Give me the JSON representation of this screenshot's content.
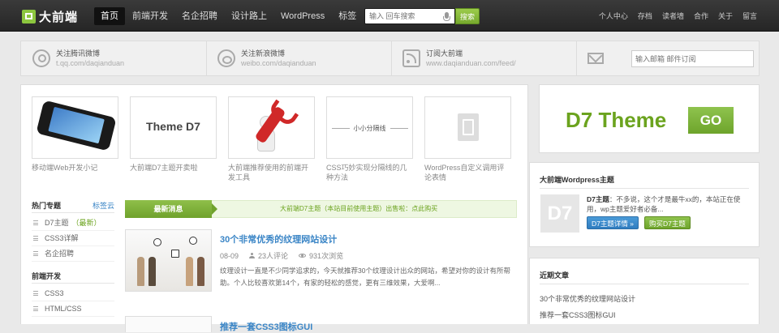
{
  "header": {
    "logo": "大前端",
    "nav": [
      "首页",
      "前端开发",
      "名企招聘",
      "设计路上",
      "WordPress",
      "标签"
    ],
    "search_placeholder": "输入 回车搜索",
    "search_button": "搜索",
    "right_links": [
      "个人中心",
      "存档",
      "读者墙",
      "合作",
      "关于",
      "留言"
    ]
  },
  "followbar": {
    "items": [
      {
        "icon": "tencent-weibo-icon",
        "title": "关注腾讯微博",
        "url": "t.qq.com/daqianduan"
      },
      {
        "icon": "sina-weibo-icon",
        "title": "关注新浪微博",
        "url": "weibo.com/daqianduan"
      },
      {
        "icon": "rss-icon",
        "title": "订阅大前端",
        "url": "www.daqianduan.com/feed/"
      }
    ],
    "subscribe_placeholder": "输入邮箱 邮件订阅"
  },
  "thumbs": [
    {
      "caption": "移动端Web开发小记"
    },
    {
      "caption": "大前端D7主题开卖啦",
      "image_text": "Theme D7"
    },
    {
      "caption": "大前端推荐使用的前端开发工具"
    },
    {
      "caption": "CSS巧妙实现分隔线的几种方法",
      "image_text": "小小分隔线"
    },
    {
      "caption": "WordPress自定义调用评论表情"
    }
  ],
  "left_sidebar": {
    "topics_title": "热门专题",
    "topics_more": "标签云",
    "topics": [
      "D7主题",
      "CSS3详解",
      "名企招聘"
    ],
    "new_tag": "（最新）",
    "dev_title": "前端开发",
    "dev_items": [
      "CSS3",
      "HTML/CSS"
    ]
  },
  "news": {
    "tab": "最新消息",
    "text": "大前端D7主题（本站目前使用主题）出售啦：点此购买"
  },
  "articles": [
    {
      "title": "30个非常优秀的纹理网站设计",
      "date": "08-09",
      "comments": "23人评论",
      "views": "931次浏览",
      "excerpt": "纹理设计一直是不少同学追求的，今天就推荐30个纹理设计出众的网站，希望对你的设计有所帮助。个人比较喜欢第14个，有家的轻松的感觉，更有三维效果，大爱啊..."
    },
    {
      "title": "推荐一套CSS3图标GUI"
    }
  ],
  "right_sidebar": {
    "banner_text": "D7 Theme",
    "banner_button": "GO",
    "wp_title": "大前端Wordpress主题",
    "wp_logo": "D7",
    "wp_desc_bold": "D7主题",
    "wp_desc": "：不多说，这个才是最牛xx的，本站正在使用，wp主题爱好者必备...",
    "btn_detail": "D7主题详情 »",
    "btn_buy": "购买D7主题",
    "recent_title": "近期文章",
    "recent_items": [
      "30个非常优秀的纹理网站设计",
      "推荐一套CSS3图标GUI"
    ]
  },
  "colors": {
    "accent_green": "#6ba31e",
    "link_blue": "#3a85c6",
    "topbar": "#2e2e2e"
  }
}
